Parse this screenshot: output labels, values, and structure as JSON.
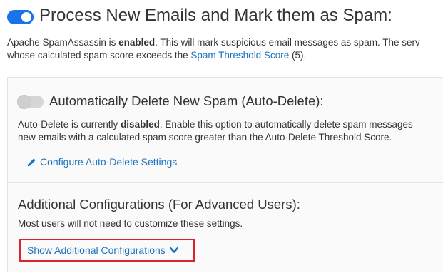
{
  "spam": {
    "title": "Process New Emails and Mark them as Spam:",
    "toggle_state": "on",
    "desc_part1": "Apache SpamAssassin is ",
    "desc_status": "enabled",
    "desc_part2": ". This will mark suspicious email messages as spam. The serv",
    "desc_line2_prefix": "whose calculated spam score exceeds the ",
    "threshold_link": "Spam Threshold Score",
    "threshold_value": " (5)."
  },
  "auto_delete": {
    "title": "Automatically Delete New Spam (Auto-Delete):",
    "toggle_state": "off",
    "desc_part1": "Auto-Delete is currently ",
    "desc_status": "disabled",
    "desc_part2": ". Enable this option to automatically delete spam messages",
    "desc_line2": "new emails with a calculated spam score greater than the Auto-Delete Threshold Score.",
    "configure_link": "Configure Auto-Delete Settings"
  },
  "advanced": {
    "title": "Additional Configurations (For Advanced Users):",
    "desc": "Most users will not need to customize these settings.",
    "show_button": "Show Additional Configurations"
  },
  "icons": {
    "configure": "pencil-icon",
    "show": "chevron-down-icon"
  },
  "colors": {
    "toggle_on": "#1a73e8",
    "link": "#1a73bf",
    "highlight_border": "#d9232d"
  }
}
